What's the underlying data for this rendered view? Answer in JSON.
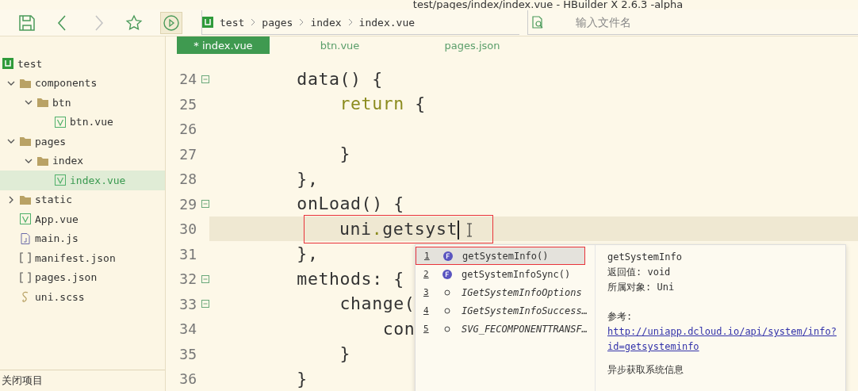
{
  "window": {
    "title": "test/pages/index/index.vue - HBuilder X 2.6.3 -alpha"
  },
  "toolbar": [
    {
      "kind": "save",
      "disabled": false
    },
    {
      "kind": "back",
      "disabled": false
    },
    {
      "kind": "forward",
      "disabled": true
    },
    {
      "kind": "star",
      "disabled": false
    },
    {
      "kind": "run",
      "disabled": false
    }
  ],
  "breadcrumb": [
    "test",
    "pages",
    "index",
    "index.vue"
  ],
  "file_search": {
    "placeholder": "输入文件名"
  },
  "sidebar": {
    "items": [
      {
        "label": "test",
        "kind": "project",
        "selected": false,
        "children": [
          {
            "label": "components",
            "kind": "folder",
            "selected": false,
            "expanded": true,
            "children": [
              {
                "label": "btn",
                "kind": "folder",
                "selected": false,
                "expanded": true,
                "children": [
                  {
                    "label": "btn.vue",
                    "kind": "vue",
                    "selected": false
                  }
                ]
              }
            ]
          },
          {
            "label": "pages",
            "kind": "folder",
            "selected": false,
            "expanded": true,
            "children": [
              {
                "label": "index",
                "kind": "folder",
                "selected": false,
                "expanded": true,
                "children": [
                  {
                    "label": "index.vue",
                    "kind": "vue",
                    "selected": true
                  }
                ]
              }
            ]
          },
          {
            "label": "static",
            "kind": "folder",
            "selected": false,
            "expanded": false
          },
          {
            "label": "App.vue",
            "kind": "vue",
            "selected": false
          },
          {
            "label": "main.js",
            "kind": "js",
            "selected": false
          },
          {
            "label": "manifest.json",
            "kind": "json",
            "selected": false
          },
          {
            "label": "pages.json",
            "kind": "json",
            "selected": false
          },
          {
            "label": "uni.scss",
            "kind": "scss",
            "selected": false
          }
        ]
      }
    ],
    "footer": "关闭项目"
  },
  "tabs": [
    {
      "label": "* index.vue",
      "selected": true
    },
    {
      "label": "btn.vue",
      "selected": false
    },
    {
      "label": "pages.json",
      "selected": false
    }
  ],
  "code_lines": [
    {
      "number": "24",
      "foldable": true,
      "current": false,
      "annotated": false,
      "tokens": [
        {
          "text": "        data() {",
          "kind": "plain"
        }
      ]
    },
    {
      "number": "25",
      "foldable": false,
      "current": false,
      "annotated": false,
      "tokens": [
        {
          "text": "            return",
          "kind": "keyword"
        },
        {
          "text": " {",
          "kind": "plain"
        }
      ]
    },
    {
      "number": "26",
      "foldable": false,
      "current": false,
      "annotated": false
    },
    {
      "number": "27",
      "foldable": false,
      "current": false,
      "annotated": false,
      "tokens": [
        {
          "text": "            }",
          "kind": "plain"
        }
      ]
    },
    {
      "number": "28",
      "foldable": false,
      "current": false,
      "annotated": false,
      "tokens": [
        {
          "text": "        },",
          "kind": "plain"
        }
      ]
    },
    {
      "number": "29",
      "foldable": true,
      "current": false,
      "annotated": false,
      "tokens": [
        {
          "text": "        onLoad() {",
          "kind": "plain"
        }
      ]
    },
    {
      "number": "30",
      "foldable": false,
      "current": true,
      "annotated": true,
      "tokens": [
        {
          "text": "uni",
          "kind": "plain"
        },
        {
          "text": ".",
          "kind": "keyword"
        },
        {
          "text": "getsyst",
          "kind": "plain"
        }
      ]
    },
    {
      "number": "31",
      "foldable": false,
      "current": false,
      "annotated": false,
      "tokens": [
        {
          "text": "        },",
          "kind": "plain"
        }
      ]
    },
    {
      "number": "32",
      "foldable": true,
      "current": false,
      "annotated": false,
      "tokens": [
        {
          "text": "        methods: {",
          "kind": "plain"
        }
      ]
    },
    {
      "number": "33",
      "foldable": true,
      "current": false,
      "annotated": false,
      "tokens": [
        {
          "text": "            change(",
          "kind": "plain"
        }
      ]
    },
    {
      "number": "34",
      "foldable": false,
      "current": false,
      "annotated": false,
      "tokens": [
        {
          "text": "                con",
          "kind": "plain"
        }
      ]
    },
    {
      "number": "35",
      "foldable": false,
      "current": false,
      "annotated": false,
      "tokens": [
        {
          "text": "            }",
          "kind": "plain"
        }
      ]
    },
    {
      "number": "36",
      "foldable": false,
      "current": false,
      "annotated": false,
      "tokens": [
        {
          "text": "        }",
          "kind": "plain"
        }
      ]
    }
  ],
  "completion": {
    "items": [
      {
        "index": "1",
        "label": "getSystemInfo()",
        "kind": "function",
        "selected": true,
        "annotated": true
      },
      {
        "index": "2",
        "label": "getSystemInfoSync()",
        "kind": "function",
        "selected": false,
        "annotated": false
      },
      {
        "index": "3",
        "label": "IGetSystemInfoOptions",
        "kind": "other",
        "selected": false,
        "annotated": false
      },
      {
        "index": "4",
        "label": "IGetSystemInfoSuccess…",
        "kind": "other",
        "selected": false,
        "annotated": false
      },
      {
        "index": "5",
        "label": "SVG_FECOMPONENTTRANSF…",
        "kind": "other",
        "selected": false,
        "annotated": false
      }
    ],
    "detail": {
      "name": "getSystemInfo",
      "returns": "返回值: void",
      "owner": "所属对象: Uni",
      "reference_label": "参考:",
      "link": "http://uniapp.dcloud.io/api/system/info?id=getsysteminfo",
      "description": "异步获取系统信息"
    }
  }
}
